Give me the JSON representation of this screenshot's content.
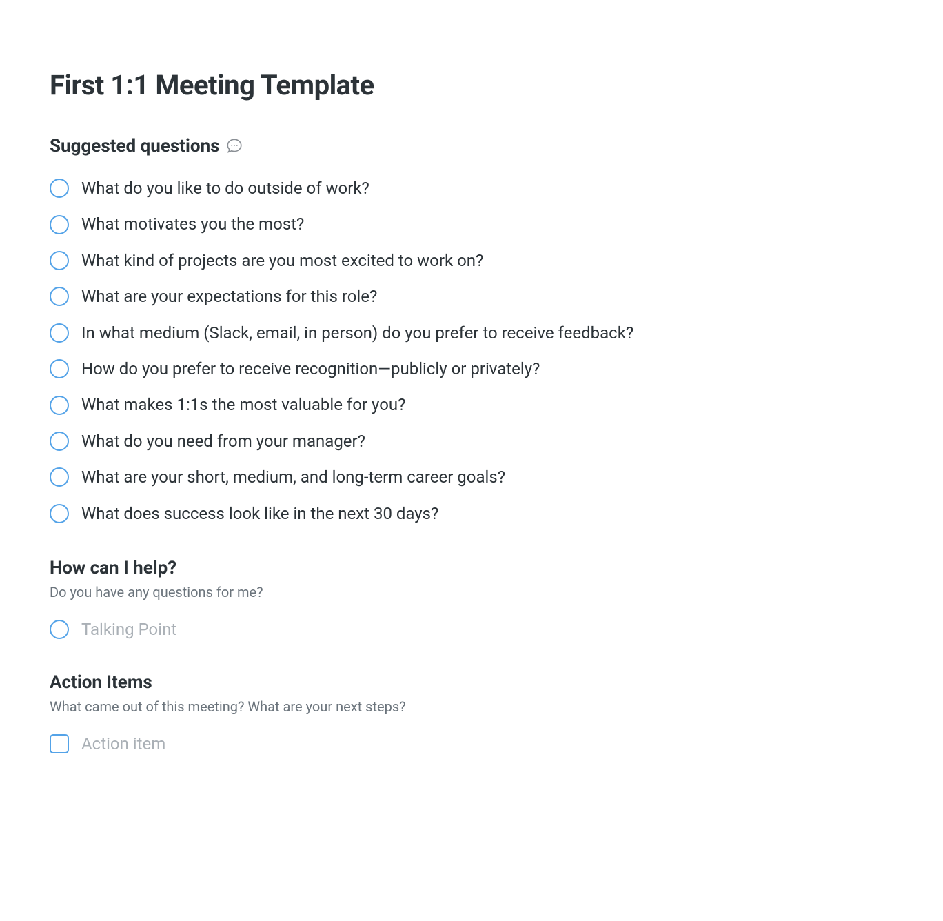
{
  "title": "First 1:1 Meeting Template",
  "sections": {
    "suggested": {
      "heading": "Suggested questions",
      "questions": [
        "What do you like to do outside of work?",
        "What motivates you the most?",
        "What kind of projects are you most excited to work on?",
        "What are your expectations for this role?",
        "In what medium (Slack, email, in person) do you prefer to receive feedback?",
        "How do you prefer to receive recognition—publicly or privately?",
        "What makes 1:1s the most valuable for you?",
        "What do you need from your manager?",
        "What are your short, medium, and long-term career goals?",
        "What does success look like in the next 30 days?"
      ]
    },
    "help": {
      "heading": "How can I help?",
      "subtitle": "Do you have any questions for me?",
      "placeholder": "Talking Point"
    },
    "action": {
      "heading": "Action Items",
      "subtitle": "What came out of this meeting? What are your next steps?",
      "placeholder": "Action item"
    }
  }
}
